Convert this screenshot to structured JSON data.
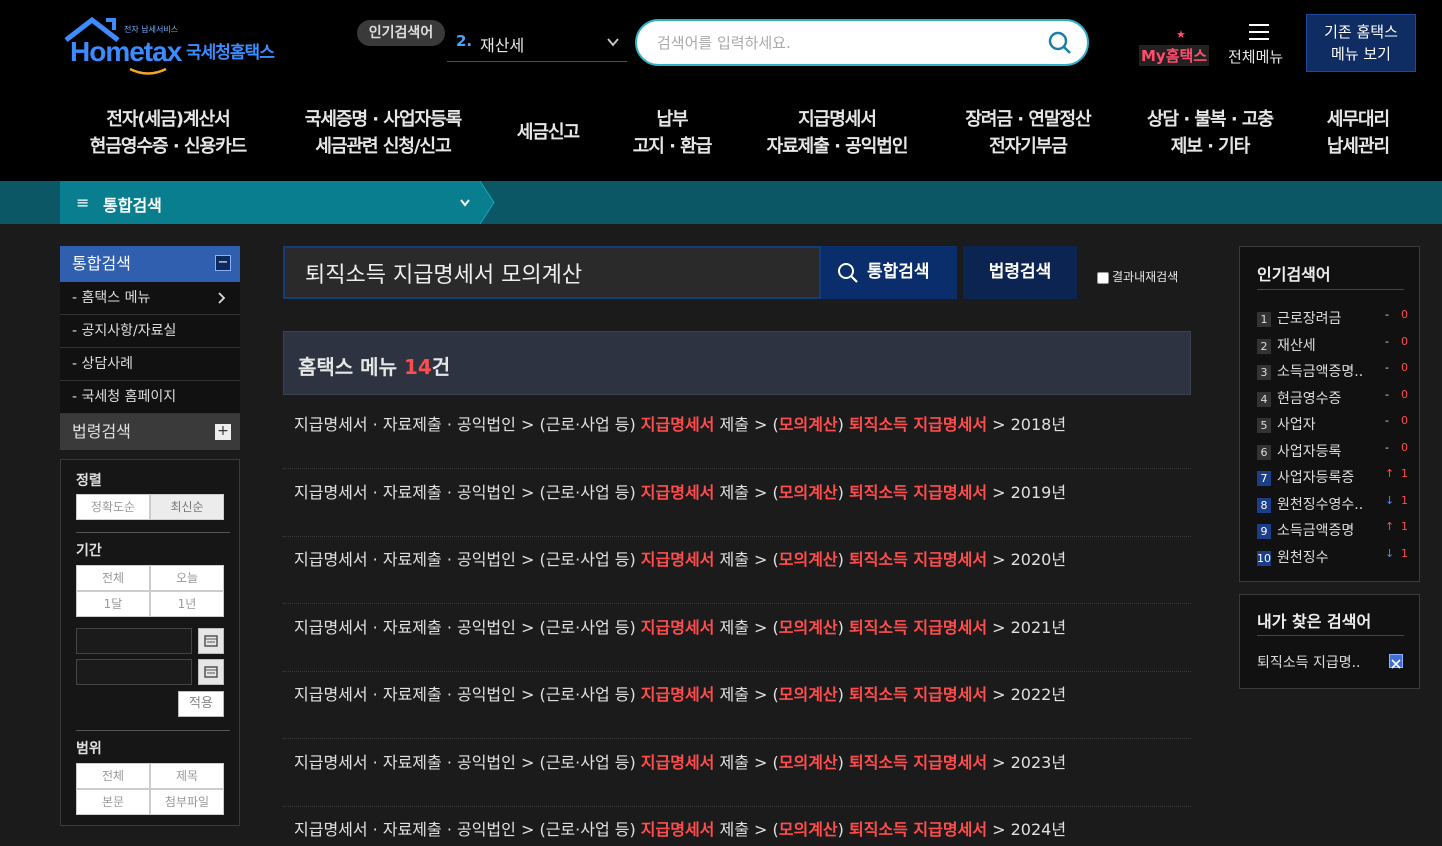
{
  "header": {
    "tagline": "전자 납세서비스",
    "brand_en": "Hometax",
    "brand_ko": "국세청홈택스",
    "popular_badge": "인기검색어",
    "popular_rank": "2.",
    "popular_term": "재산세",
    "search_placeholder": "검색어를 입력하세요.",
    "my_hometax": "My홈택스",
    "all_menu": "전체메뉴",
    "old_menu_line1": "기존 홈택스",
    "old_menu_line2": "메뉴 보기"
  },
  "gnb": [
    {
      "l1": "전자(세금)계산서",
      "l2": "현금영수증 · 신용카드"
    },
    {
      "l1": "국세증명 · 사업자등록",
      "l2": "세금관련 신청/신고"
    },
    {
      "l1": "세금신고",
      "l2": ""
    },
    {
      "l1": "납부",
      "l2": "고지 · 환급"
    },
    {
      "l1": "지급명세서",
      "l2": "자료제출 · 공익법인"
    },
    {
      "l1": "장려금 · 연말정산",
      "l2": "전자기부금"
    },
    {
      "l1": "상담 · 불복 · 고충",
      "l2": "제보 · 기타"
    },
    {
      "l1": "세무대리",
      "l2": "납세관리"
    }
  ],
  "breadcrumb": {
    "label": "통합검색"
  },
  "sidebar": {
    "section1": "통합검색",
    "section1_toggle": "−",
    "items": [
      "- 홈택스 메뉴",
      "- 공지사항/자료실",
      "- 상담사례",
      "- 국세청 홈페이지"
    ],
    "section2": "법령검색",
    "section2_toggle": "+"
  },
  "filter": {
    "sort_title": "정렬",
    "sort_options": [
      "정확도순",
      "최신순"
    ],
    "period_title": "기간",
    "period_options": [
      "전체",
      "오늘",
      "1달",
      "1년"
    ],
    "apply": "적용",
    "scope_title": "범위",
    "scope_options": [
      "전체",
      "제목",
      "본문",
      "첨부파일"
    ]
  },
  "search": {
    "query": "퇴직소득 지급명세서 모의계산",
    "btn_total": "통합검색",
    "btn_law": "법령검색",
    "within_results": "결과내재검색"
  },
  "results": {
    "head_label": "홈택스 메뉴 ",
    "head_count": "14",
    "head_suffix": "건",
    "rows": [
      {
        "year": "2018년"
      },
      {
        "year": "2019년"
      },
      {
        "year": "2020년"
      },
      {
        "year": "2021년"
      },
      {
        "year": "2022년"
      },
      {
        "year": "2023년"
      },
      {
        "year": "2024년"
      }
    ],
    "path": {
      "p1": "지급명세서 · 자료제출 · 공익법인 > (근로·사업 등) ",
      "h1": "지급명세서",
      "p2": " 제출 > (",
      "h2": "모의계산",
      "p3": ") ",
      "h3": "퇴직소득 지급명세서",
      "p4": " > "
    }
  },
  "popular": {
    "title": "인기검색어",
    "items": [
      {
        "rank": "1",
        "word": "근로장려금",
        "move": "-",
        "value": "0",
        "dir": "same"
      },
      {
        "rank": "2",
        "word": "재산세",
        "move": "-",
        "value": "0",
        "dir": "same"
      },
      {
        "rank": "3",
        "word": "소득금액증명..",
        "move": "-",
        "value": "0",
        "dir": "same"
      },
      {
        "rank": "4",
        "word": "현금영수증",
        "move": "-",
        "value": "0",
        "dir": "same"
      },
      {
        "rank": "5",
        "word": "사업자",
        "move": "-",
        "value": "0",
        "dir": "same"
      },
      {
        "rank": "6",
        "word": "사업자등록",
        "move": "-",
        "value": "0",
        "dir": "same"
      },
      {
        "rank": "7",
        "word": "사업자등록증",
        "move": "↑",
        "value": "1",
        "dir": "up"
      },
      {
        "rank": "8",
        "word": "원천징수영수..",
        "move": "↓",
        "value": "1",
        "dir": "down"
      },
      {
        "rank": "9",
        "word": "소득금액증명",
        "move": "↑",
        "value": "1",
        "dir": "up"
      },
      {
        "rank": "10",
        "word": "원천징수",
        "move": "↓",
        "value": "1",
        "dir": "down"
      }
    ]
  },
  "my_search": {
    "title": "내가 찾은 검색어",
    "item": "퇴직소득 지급명.."
  },
  "colors": {
    "accent_red": "#ff4d4d",
    "teal": "#097e8f",
    "navy": "#0a2d6b"
  }
}
